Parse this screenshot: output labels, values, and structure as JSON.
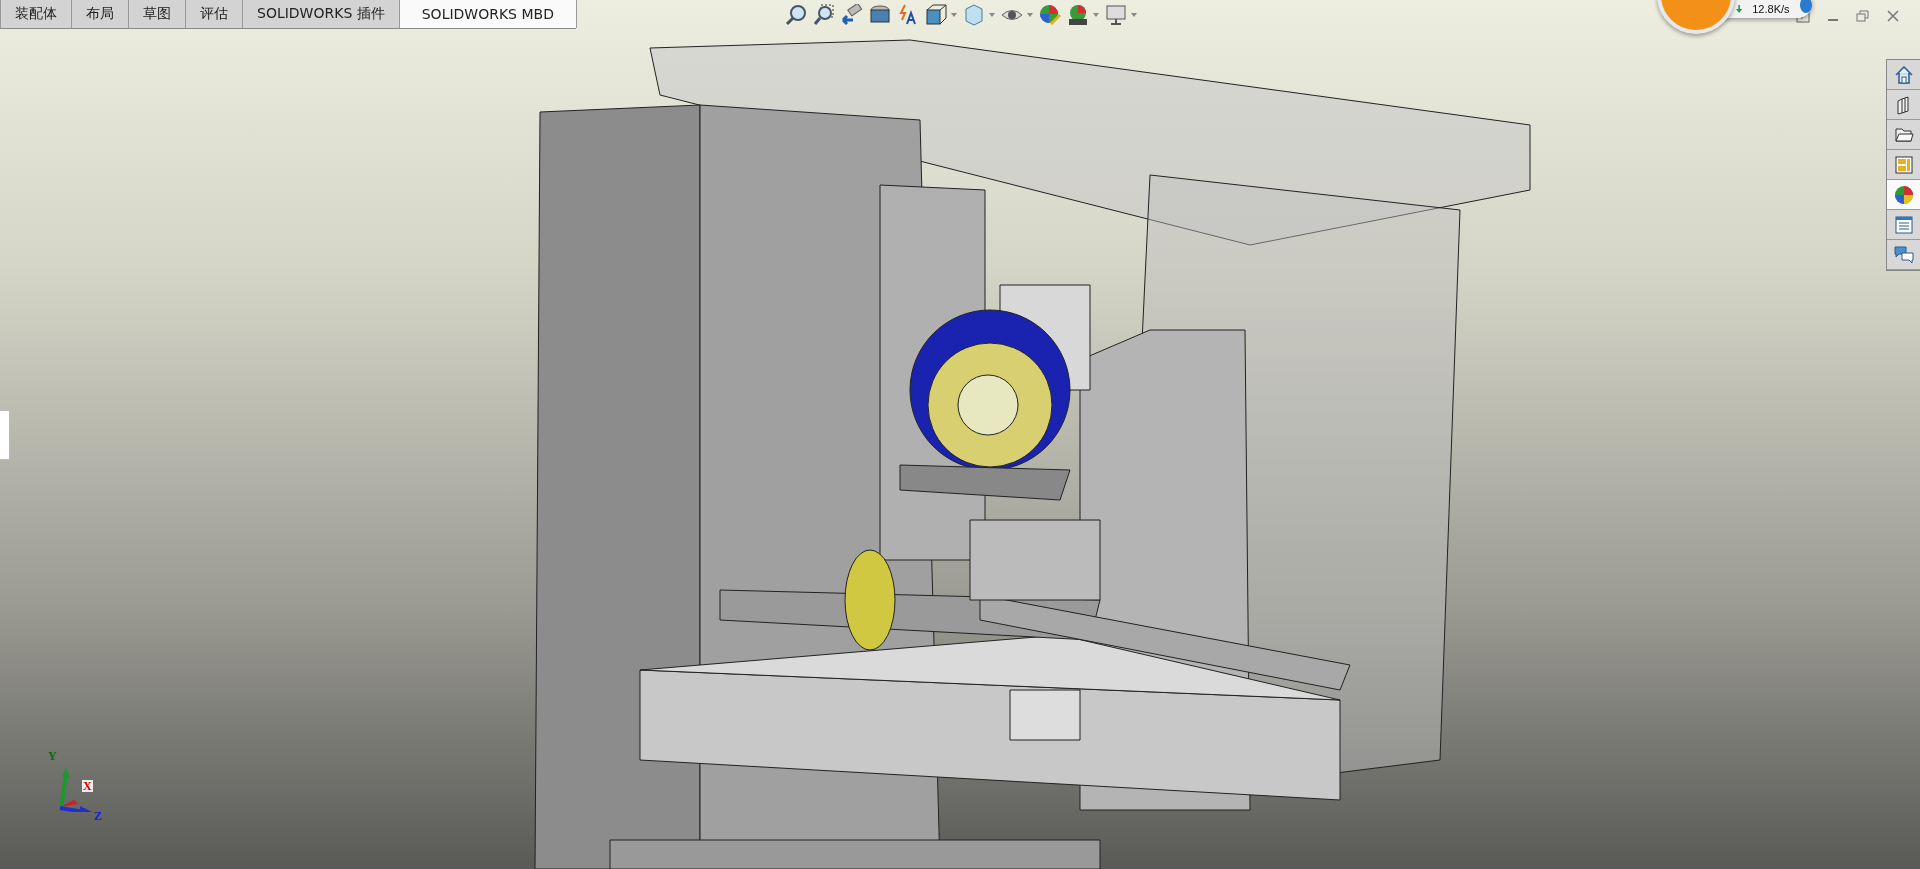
{
  "tabs": [
    {
      "label": "装配体",
      "selected": false
    },
    {
      "label": "布局",
      "selected": false
    },
    {
      "label": "草图",
      "selected": false
    },
    {
      "label": "评估",
      "selected": false
    },
    {
      "label": "SOLIDWORKS 插件",
      "selected": false
    },
    {
      "label": "SOLIDWORKS MBD",
      "selected": true
    }
  ],
  "network_widget": {
    "speed": "12.8K/s"
  },
  "task_pane": {
    "tabs": [
      {
        "kind": "home",
        "selected": false
      },
      {
        "kind": "library",
        "selected": false
      },
      {
        "kind": "folder",
        "selected": false
      },
      {
        "kind": "palette",
        "selected": false
      },
      {
        "kind": "appearance",
        "selected": true
      },
      {
        "kind": "properties",
        "selected": false
      },
      {
        "kind": "forum",
        "selected": false
      }
    ]
  },
  "triad": {
    "y_label": "Y",
    "x_label": "X",
    "z_label": "Z"
  }
}
